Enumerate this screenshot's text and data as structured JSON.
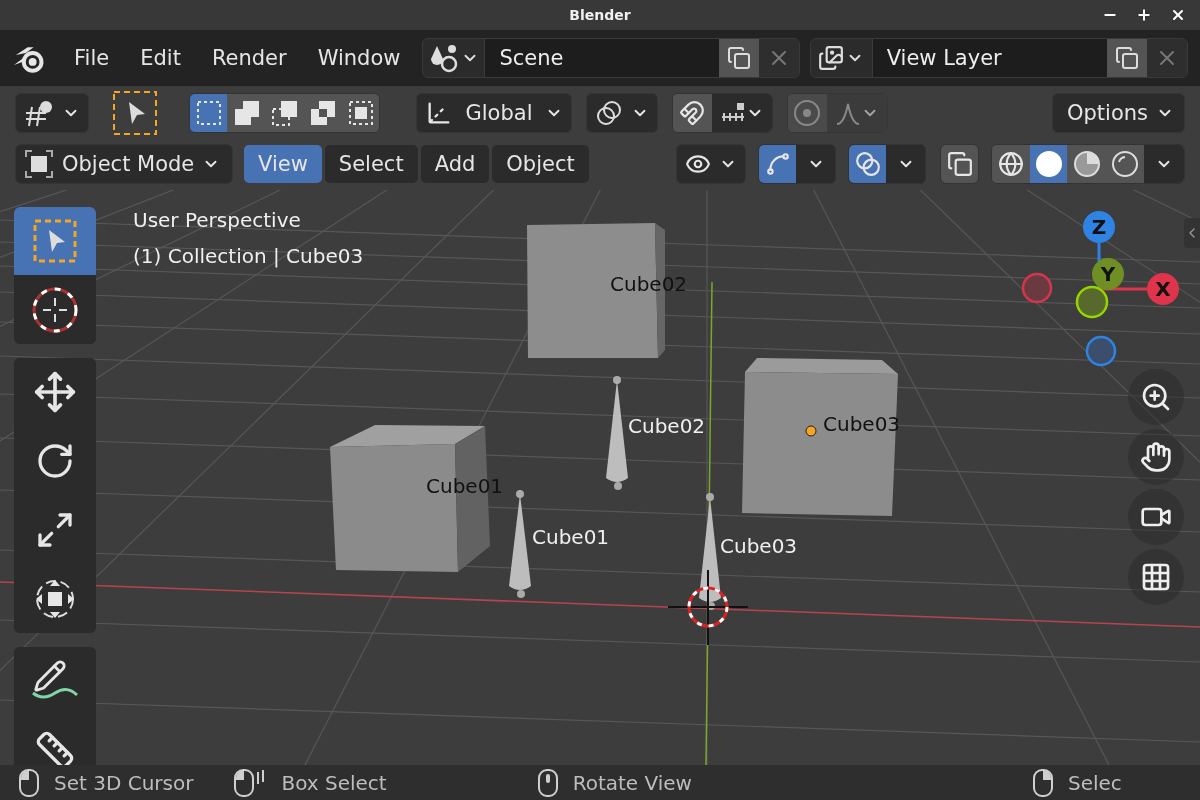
{
  "window": {
    "title": "Blender"
  },
  "topbar": {
    "menus": [
      "File",
      "Edit",
      "Render",
      "Window"
    ],
    "scene": {
      "value": "Scene"
    },
    "view_layer": {
      "value": "View Layer"
    }
  },
  "tool_settings": {
    "select_modes": [
      {
        "kind": "set",
        "selected": true
      },
      {
        "kind": "extend",
        "selected": false
      },
      {
        "kind": "subtract",
        "selected": false
      },
      {
        "kind": "difference",
        "selected": false
      },
      {
        "kind": "intersect",
        "selected": false
      }
    ],
    "orientation": "Global",
    "options": "Options"
  },
  "header": {
    "mode": "Object Mode",
    "menus": [
      {
        "label": "View",
        "selected": true
      },
      {
        "label": "Select",
        "selected": false
      },
      {
        "label": "Add",
        "selected": false
      },
      {
        "label": "Object",
        "selected": false
      }
    ],
    "gizmos_on": true,
    "overlays_on": true,
    "shading": [
      {
        "kind": "wireframe",
        "selected": false
      },
      {
        "kind": "solid",
        "selected": true
      },
      {
        "kind": "material",
        "selected": false
      },
      {
        "kind": "rendered",
        "selected": false
      }
    ]
  },
  "viewport": {
    "info": [
      "User Perspective",
      "(1) Collection | Cube03"
    ],
    "labels": [
      {
        "text": "Cube02",
        "kind": "mesh"
      },
      {
        "text": "Cube03",
        "kind": "mesh"
      },
      {
        "text": "Cube02",
        "kind": "empty"
      },
      {
        "text": "Cube01",
        "kind": "mesh"
      },
      {
        "text": "Cube01",
        "kind": "empty"
      },
      {
        "text": "Cube03",
        "kind": "empty"
      }
    ],
    "axes": [
      "Z",
      "Y",
      "X"
    ]
  },
  "toolbar": [
    [
      {
        "kind": "select",
        "selected": true
      },
      {
        "kind": "cursor",
        "selected": false
      }
    ],
    [
      {
        "kind": "move",
        "selected": false
      },
      {
        "kind": "rotate",
        "selected": false
      },
      {
        "kind": "scale",
        "selected": false
      },
      {
        "kind": "transform",
        "selected": false
      }
    ],
    [
      {
        "kind": "annotate",
        "selected": false
      },
      {
        "kind": "measure",
        "selected": false
      }
    ]
  ],
  "status_bar": [
    {
      "label": "Set 3D Cursor",
      "kind": "left"
    },
    {
      "label": "Box Select",
      "kind": "drag"
    },
    {
      "label": "Rotate View",
      "kind": "middle"
    },
    {
      "label": "Selec",
      "kind": "right"
    }
  ]
}
